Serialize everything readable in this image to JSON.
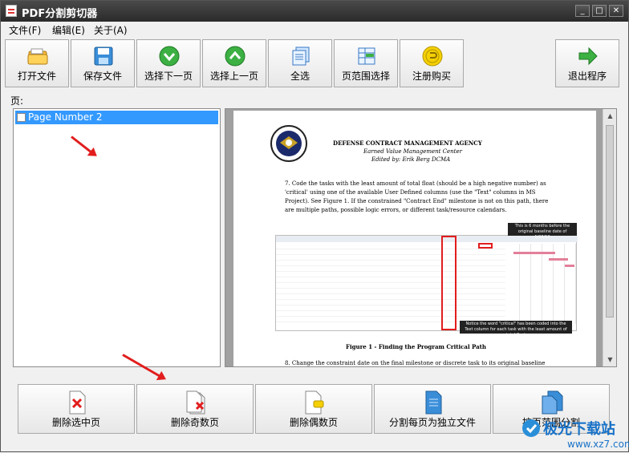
{
  "window": {
    "title": "PDF分割剪切器",
    "minimize": "_",
    "maximize": "□",
    "close": "✕"
  },
  "menu": [
    {
      "label": "文件(F)"
    },
    {
      "label": "编辑(E)"
    },
    {
      "label": "关于(A)"
    }
  ],
  "toolbar": [
    {
      "label": "打开文件",
      "icon": "open-folder-icon"
    },
    {
      "label": "保存文件",
      "icon": "floppy-disk-icon"
    },
    {
      "label": "选择下一页",
      "icon": "arrow-down-icon"
    },
    {
      "label": "选择上一页",
      "icon": "arrow-up-icon"
    },
    {
      "label": "全选",
      "icon": "select-all-icon"
    },
    {
      "label": "页范围选择",
      "icon": "page-range-icon"
    },
    {
      "label": "注册购买",
      "icon": "register-coin-icon"
    },
    {
      "label": "退出程序",
      "icon": "exit-arrow-icon"
    }
  ],
  "pages_label": "页:",
  "page_list": [
    {
      "label": "Page Number 2",
      "checked": false,
      "selected": true
    }
  ],
  "preview": {
    "agency": "DEFENSE CONTRACT MANAGEMENT AGENCY",
    "center": "Earned Value Management Center",
    "editor": "Edited by: Erik Berg DCMA",
    "step7": "7.   Code the tasks with the least amount of total float (should be a high negative number) as 'critical' using one of the available User Defined columns (use the \"Text\" columns in MS Project). See Figure 1.   If the constrained \"Contract End\" milestone is not on this path, there are multiple paths, possible logic errors, or different task/resource calendars.",
    "callout_top": "This is 6 months before the original baseline date of 1/23/12",
    "callout_bottom": "Notice the word \"critical\" has been coded into the Text column for each task with the least amount of total float",
    "figure_caption": "Figure 1 - Finding the Program Critical Path",
    "step8": "8.   Change the constraint date on the final milestone or discrete task to its original baseline"
  },
  "bottom_buttons": [
    {
      "label": "删除选中页",
      "icon": "delete-page-icon"
    },
    {
      "label": "删除奇数页",
      "icon": "delete-odd-pages-icon"
    },
    {
      "label": "删除偶数页",
      "icon": "delete-even-pages-icon"
    },
    {
      "label": "分割每页为独立文件",
      "icon": "split-pages-icon"
    },
    {
      "label": "按页范围分割",
      "icon": "split-range-icon"
    }
  ],
  "watermark": {
    "text": "极光下载站",
    "url": "www.xz7.com"
  },
  "colors": {
    "selection": "#3399ff",
    "titlebar": "#2f2f2f",
    "annotation_arrow": "#e21d1d"
  }
}
